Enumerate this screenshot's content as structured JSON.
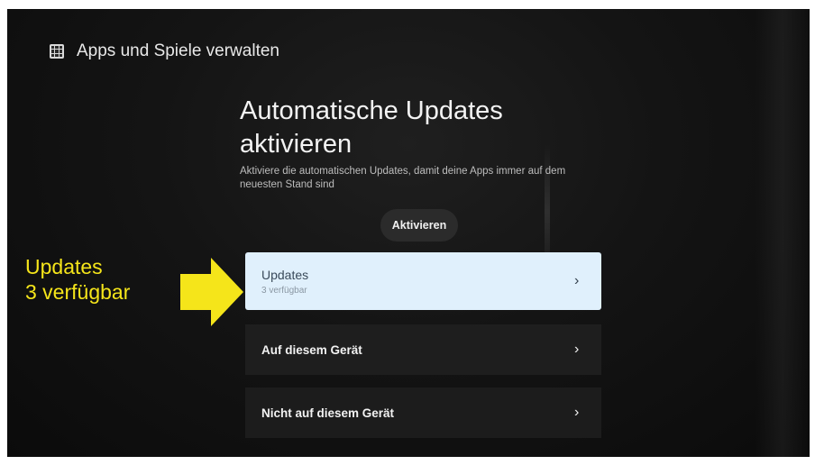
{
  "header": {
    "title": "Apps und Spiele verwalten",
    "icon": "apps-grid-icon"
  },
  "hero": {
    "title": "Automatische Updates aktivieren",
    "description": "Aktiviere die automatischen Updates, damit deine Apps immer auf dem neuesten Stand sind"
  },
  "activate_button": {
    "label": "Aktivieren"
  },
  "menu": [
    {
      "label": "Updates",
      "sub": "3 verfügbar",
      "focused": true
    },
    {
      "label": "Auf diesem Gerät"
    },
    {
      "label": "Nicht auf diesem Gerät"
    }
  ],
  "annotation": {
    "line1": "Updates",
    "line2": "3 verfügbar",
    "color": "#f5e51a"
  },
  "colors": {
    "focus_bg": "#e0f0fc",
    "background": "#141414",
    "arrow": "#f5e51a"
  }
}
